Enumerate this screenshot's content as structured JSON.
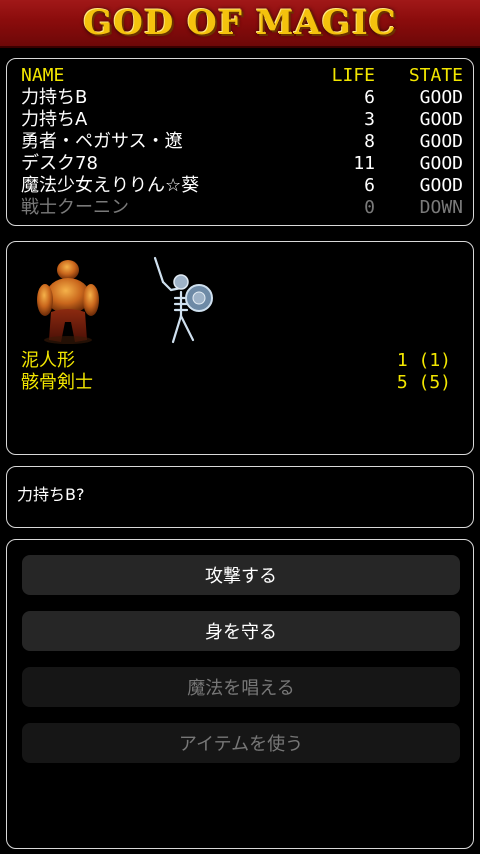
{
  "header": {
    "title": "GOD OF MAGIC"
  },
  "party": {
    "columns": {
      "name": "NAME",
      "life": "LIFE",
      "state": "STATE"
    },
    "members": [
      {
        "name": "力持ちB",
        "life": "6",
        "state": "GOOD",
        "down": false
      },
      {
        "name": "力持ちA",
        "life": "3",
        "state": "GOOD",
        "down": false
      },
      {
        "name": "勇者・ペガサス・遼",
        "life": "8",
        "state": "GOOD",
        "down": false
      },
      {
        "name": "デスク78",
        "life": "11",
        "state": "GOOD",
        "down": false
      },
      {
        "name": "魔法少女えりりん☆葵",
        "life": "6",
        "state": "GOOD",
        "down": false
      },
      {
        "name": "戦士クーニン",
        "life": "0",
        "state": "DOWN",
        "down": true
      }
    ]
  },
  "enemies": {
    "groups": [
      {
        "name": "泥人形",
        "count": "1 (1)",
        "sprite": "clay-golem"
      },
      {
        "name": "骸骨剣士",
        "count": "5 (5)",
        "sprite": "skeleton-swordsman"
      }
    ]
  },
  "message": {
    "text": "力持ちB?"
  },
  "commands": [
    {
      "label": "攻撃する",
      "enabled": true
    },
    {
      "label": "身を守る",
      "enabled": true
    },
    {
      "label": "魔法を唱える",
      "enabled": false
    },
    {
      "label": "アイテムを使う",
      "enabled": false
    }
  ],
  "colors": {
    "highlight": "#f2e600",
    "title_gold": "#f4c20d",
    "title_bar": "#8a0c0c",
    "disabled_text": "#7a7a7a"
  }
}
